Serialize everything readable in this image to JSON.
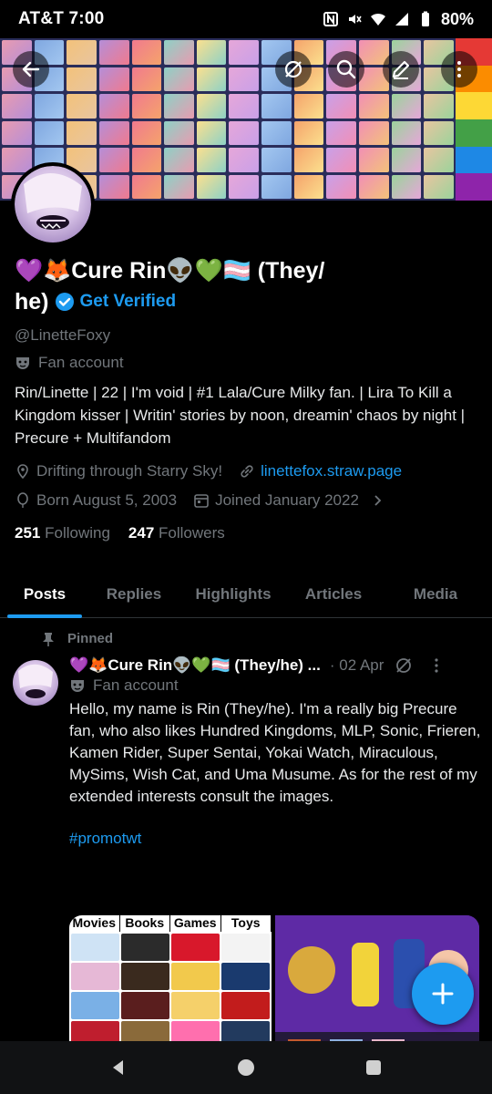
{
  "status_bar": {
    "carrier_time": "AT&T 7:00",
    "battery": "80%"
  },
  "banner": {
    "tile_colors": [
      "#e89bb0",
      "#7fa7e0",
      "#f3c27a",
      "#b58ed8",
      "#f07a8e",
      "#8ed1c6",
      "#fbe08e",
      "#e6a7d9",
      "#a3c7f0",
      "#f5a36b",
      "#c9a0e8",
      "#f28fb5",
      "#9bd39b",
      "#e8c5a0"
    ],
    "pride_colors": [
      "#e53935",
      "#fb8c00",
      "#fdd835",
      "#43a047",
      "#1e88e5",
      "#8e24aa"
    ],
    "buttons": [
      "back-icon",
      "no-notify-icon",
      "search-icon",
      "edit-icon",
      "more-icon"
    ]
  },
  "profile": {
    "display_name_line1": "💜🦊Cure Rin👽💚🏳️‍⚧️ (They/",
    "display_name_line2": "he)",
    "get_verified": "Get Verified",
    "handle": "@LinetteFoxy",
    "category": "Fan account",
    "bio": "Rin/Linette | 22 | I'm void | #1 Lala/Cure Milky fan. | Lira To Kill a Kingdom kisser | Writin' stories by noon, dreamin' chaos by night | Precure + Multifandom",
    "location": "Drifting through Starry Sky!",
    "website": "linettefox.straw.page",
    "birthday": "Born August 5, 2003",
    "joined": "Joined January 2022",
    "following_count": "251",
    "following_label": "Following",
    "followers_count": "247",
    "followers_label": "Followers"
  },
  "tabs": [
    "Posts",
    "Replies",
    "Highlights",
    "Articles",
    "Media"
  ],
  "post": {
    "pinned_label": "Pinned",
    "author": "💜🦊Cure Rin👽💚🏳️‍⚧️ (They/he) ...",
    "date": "· 02 Apr",
    "category": "Fan account",
    "text": "Hello, my name is Rin (They/he). I'm a really big Precure fan, who also likes Hundred Kingdoms, MLP, Sonic, Frieren, Kamen Rider, Super Sentai, Yokai Watch, Miraculous, MySims, Wish Cat, and Uma Musume. As for the rest of my extended interests consult the images.",
    "hashtag": "#promotwt",
    "media_headers": [
      "Movies",
      "Books",
      "Games",
      "Toys"
    ]
  },
  "colors": {
    "accent": "#1d9bf0",
    "background": "#000000",
    "muted": "#71767b"
  }
}
